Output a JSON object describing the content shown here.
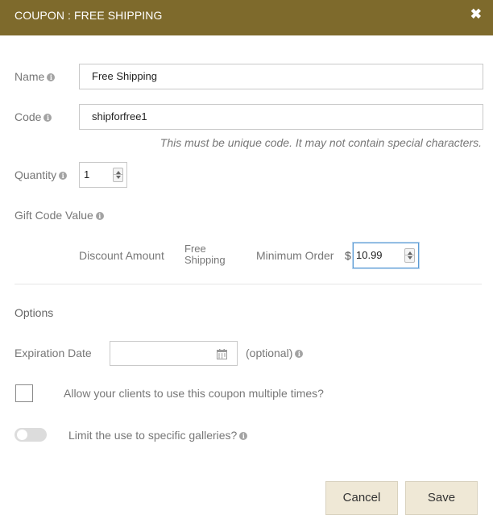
{
  "dialog": {
    "title": "COUPON : FREE SHIPPING",
    "close_glyph": "✖"
  },
  "info_glyph": "i",
  "form": {
    "name": {
      "label": "Name",
      "value": "Free Shipping"
    },
    "code": {
      "label": "Code",
      "value": "shipforfree1",
      "hint": "This must be unique code. It may not contain special characters."
    },
    "quantity": {
      "label": "Quantity",
      "value": "1"
    },
    "gift_code_value": {
      "label": "Gift Code Value",
      "discount_amount_label": "Discount Amount",
      "discount_amount_value_line1": "Free",
      "discount_amount_value_line2": "Shipping",
      "minimum_order_label": "Minimum Order",
      "currency_symbol": "$",
      "minimum_order_value": "10.99"
    }
  },
  "options": {
    "heading": "Options",
    "expiration_date": {
      "label": "Expiration Date",
      "value": "",
      "optional_text": "(optional)"
    },
    "multiple_use": {
      "label": "Allow your clients to use this coupon multiple times?",
      "checked": false
    },
    "limit_galleries": {
      "label": "Limit the use to specific galleries?",
      "enabled": false
    }
  },
  "buttons": {
    "cancel": "Cancel",
    "save": "Save"
  },
  "colors": {
    "header_bg": "#7e6a2c",
    "button_bg": "#efe8d6",
    "focus_border": "#5b9bd5"
  },
  "icons": {
    "close": "close-icon",
    "info": "info-icon",
    "calendar": "calendar-icon",
    "spinner": "number-spinner-icon"
  }
}
